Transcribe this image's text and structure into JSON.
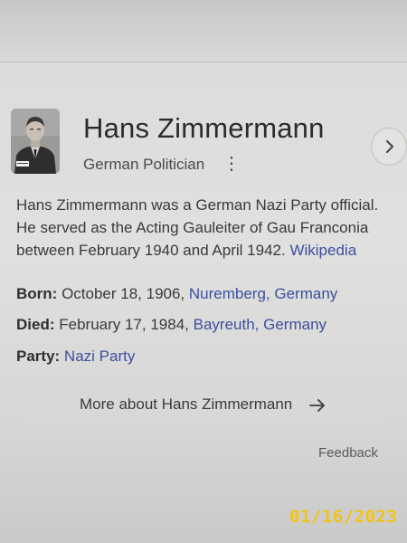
{
  "entity": {
    "name": "Hans Zimmermann",
    "subtitle": "German Politician",
    "more_options_glyph": "⋮",
    "photo_icon": "portrait-photo",
    "next_icon": "chevron-right-icon"
  },
  "description": {
    "lines": [
      "Hans Zimmermann was a German Nazi Party official.",
      "He served as the Acting Gauleiter of Gau Franconia",
      "between February 1940 and April 1942."
    ],
    "source_link": "Wikipedia"
  },
  "facts": {
    "born": {
      "label": "Born:",
      "value": "October 18, 1906,",
      "link": "Nuremberg, Germany"
    },
    "died": {
      "label": "Died:",
      "value": "February 17, 1984,",
      "link": "Bayreuth, Germany"
    },
    "party": {
      "label": "Party:",
      "link": "Nazi Party"
    }
  },
  "more_about": {
    "label": "More about Hans Zimmermann",
    "icon": "arrow-right-icon"
  },
  "feedback": {
    "label": "Feedback"
  },
  "date_stamp": "01/16/2023",
  "colors": {
    "link": "#3d4fa0",
    "date_stamp": "#f2c21a",
    "text": "#3a3a3c"
  }
}
